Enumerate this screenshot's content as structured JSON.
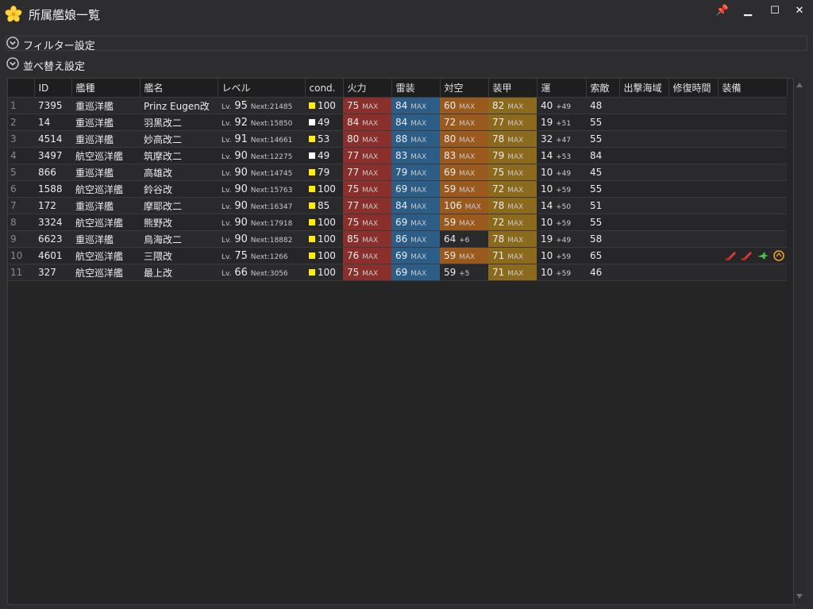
{
  "window": {
    "title": "所属艦娘一覧",
    "pin": "📌",
    "minimize": "▁",
    "maximize": "☐",
    "close": "✕"
  },
  "sections": {
    "filter": "フィルター設定",
    "sort": "並べ替え設定"
  },
  "columns": [
    "",
    "ID",
    "艦種",
    "艦名",
    "レベル",
    "cond.",
    "火力",
    "雷装",
    "対空",
    "装甲",
    "運",
    "索敵",
    "出撃海域",
    "修復時間",
    "装備"
  ],
  "labels": {
    "lv": "Lv.",
    "next": "Next:",
    "max": "MAX"
  },
  "colors": {
    "fire_max": "#8a2f2b",
    "torp_max": "#2b5d87",
    "aa_max": "#9a5a1e",
    "armor_max": "#8c6a1d",
    "cond_yellow": "#ffee00",
    "cond_white": "#ffffff"
  },
  "rows": [
    {
      "n": "1",
      "id": "7395",
      "type": "重巡洋艦",
      "name": "Prinz Eugen改",
      "lv": "95",
      "next": "21485",
      "cond": "100",
      "cond_color": "yellow",
      "fire": "75",
      "fire_max": true,
      "fire_plus": "",
      "torp": "84",
      "torp_max": true,
      "torp_plus": "",
      "aa": "60",
      "aa_max": true,
      "aa_plus": "",
      "armor": "82",
      "armor_max": true,
      "armor_plus": "",
      "luck": "40",
      "luck_plus": "+49",
      "los": "48",
      "equip": []
    },
    {
      "n": "2",
      "id": "14",
      "type": "重巡洋艦",
      "name": "羽黒改二",
      "lv": "92",
      "next": "15850",
      "cond": "49",
      "cond_color": "white",
      "fire": "84",
      "fire_max": true,
      "fire_plus": "",
      "torp": "84",
      "torp_max": true,
      "torp_plus": "",
      "aa": "72",
      "aa_max": true,
      "aa_plus": "",
      "armor": "77",
      "armor_max": true,
      "armor_plus": "",
      "luck": "19",
      "luck_plus": "+51",
      "los": "55",
      "equip": []
    },
    {
      "n": "3",
      "id": "4514",
      "type": "重巡洋艦",
      "name": "妙高改二",
      "lv": "91",
      "next": "14661",
      "cond": "53",
      "cond_color": "yellow",
      "fire": "80",
      "fire_max": true,
      "fire_plus": "",
      "torp": "88",
      "torp_max": true,
      "torp_plus": "",
      "aa": "80",
      "aa_max": true,
      "aa_plus": "",
      "armor": "78",
      "armor_max": true,
      "armor_plus": "",
      "luck": "32",
      "luck_plus": "+47",
      "los": "55",
      "equip": []
    },
    {
      "n": "4",
      "id": "3497",
      "type": "航空巡洋艦",
      "name": "筑摩改二",
      "lv": "90",
      "next": "12275",
      "cond": "49",
      "cond_color": "white",
      "fire": "77",
      "fire_max": true,
      "fire_plus": "",
      "torp": "83",
      "torp_max": true,
      "torp_plus": "",
      "aa": "83",
      "aa_max": true,
      "aa_plus": "",
      "armor": "79",
      "armor_max": true,
      "armor_plus": "",
      "luck": "14",
      "luck_plus": "+53",
      "los": "84",
      "equip": []
    },
    {
      "n": "5",
      "id": "866",
      "type": "重巡洋艦",
      "name": "高雄改",
      "lv": "90",
      "next": "14745",
      "cond": "79",
      "cond_color": "yellow",
      "fire": "77",
      "fire_max": true,
      "fire_plus": "",
      "torp": "79",
      "torp_max": true,
      "torp_plus": "",
      "aa": "69",
      "aa_max": true,
      "aa_plus": "",
      "armor": "75",
      "armor_max": true,
      "armor_plus": "",
      "luck": "10",
      "luck_plus": "+49",
      "los": "45",
      "equip": []
    },
    {
      "n": "6",
      "id": "1588",
      "type": "航空巡洋艦",
      "name": "鈴谷改",
      "lv": "90",
      "next": "15763",
      "cond": "100",
      "cond_color": "yellow",
      "fire": "75",
      "fire_max": true,
      "fire_plus": "",
      "torp": "69",
      "torp_max": true,
      "torp_plus": "",
      "aa": "59",
      "aa_max": true,
      "aa_plus": "",
      "armor": "72",
      "armor_max": true,
      "armor_plus": "",
      "luck": "10",
      "luck_plus": "+59",
      "los": "55",
      "equip": []
    },
    {
      "n": "7",
      "id": "172",
      "type": "重巡洋艦",
      "name": "摩耶改二",
      "lv": "90",
      "next": "16347",
      "cond": "85",
      "cond_color": "yellow",
      "fire": "77",
      "fire_max": true,
      "fire_plus": "",
      "torp": "84",
      "torp_max": true,
      "torp_plus": "",
      "aa": "106",
      "aa_max": true,
      "aa_plus": "",
      "armor": "78",
      "armor_max": true,
      "armor_plus": "",
      "luck": "14",
      "luck_plus": "+50",
      "los": "51",
      "equip": []
    },
    {
      "n": "8",
      "id": "3324",
      "type": "航空巡洋艦",
      "name": "熊野改",
      "lv": "90",
      "next": "17918",
      "cond": "100",
      "cond_color": "yellow",
      "fire": "75",
      "fire_max": true,
      "fire_plus": "",
      "torp": "69",
      "torp_max": true,
      "torp_plus": "",
      "aa": "59",
      "aa_max": true,
      "aa_plus": "",
      "armor": "72",
      "armor_max": true,
      "armor_plus": "",
      "luck": "10",
      "luck_plus": "+59",
      "los": "55",
      "equip": []
    },
    {
      "n": "9",
      "id": "6623",
      "type": "重巡洋艦",
      "name": "鳥海改二",
      "lv": "90",
      "next": "18882",
      "cond": "100",
      "cond_color": "yellow",
      "fire": "85",
      "fire_max": true,
      "fire_plus": "",
      "torp": "86",
      "torp_max": true,
      "torp_plus": "",
      "aa": "64",
      "aa_max": false,
      "aa_plus": "+6",
      "armor": "78",
      "armor_max": true,
      "armor_plus": "",
      "luck": "19",
      "luck_plus": "+49",
      "los": "58",
      "equip": []
    },
    {
      "n": "10",
      "id": "4601",
      "type": "航空巡洋艦",
      "name": "三隈改",
      "lv": "75",
      "next": "1266",
      "cond": "100",
      "cond_color": "yellow",
      "fire": "76",
      "fire_max": true,
      "fire_plus": "",
      "torp": "69",
      "torp_max": true,
      "torp_plus": "",
      "aa": "59",
      "aa_max": true,
      "aa_plus": "",
      "armor": "71",
      "armor_max": true,
      "armor_plus": "",
      "luck": "10",
      "luck_plus": "+59",
      "los": "65",
      "equip": [
        "main-gun-red-icon",
        "main-gun-red-icon",
        "seaplane-green-icon",
        "radar-orange-icon"
      ]
    },
    {
      "n": "11",
      "id": "327",
      "type": "航空巡洋艦",
      "name": "最上改",
      "lv": "66",
      "next": "3056",
      "cond": "100",
      "cond_color": "yellow",
      "fire": "75",
      "fire_max": true,
      "fire_plus": "",
      "torp": "69",
      "torp_max": true,
      "torp_plus": "",
      "aa": "59",
      "aa_max": false,
      "aa_plus": "+5",
      "armor": "71",
      "armor_max": true,
      "armor_plus": "",
      "luck": "10",
      "luck_plus": "+59",
      "los": "46",
      "equip": []
    }
  ]
}
